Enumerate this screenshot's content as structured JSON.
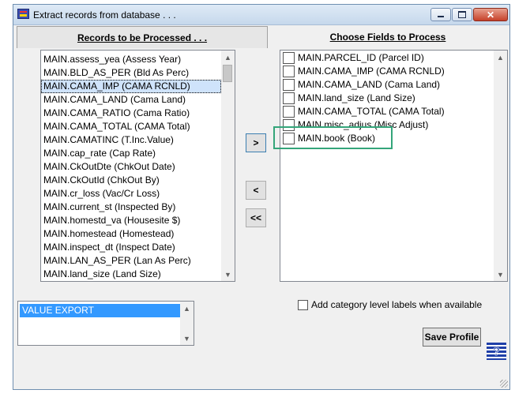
{
  "window": {
    "title": "Extract records from database . . ."
  },
  "left_panel": {
    "header": "Records to be Processed . . .",
    "items": [
      "MAIN.assess_yea (Assess Year)",
      "MAIN.BLD_AS_PER (Bld As Perc)",
      "MAIN.CAMA_IMP (CAMA RCNLD)",
      "MAIN.CAMA_LAND (Cama Land)",
      "MAIN.CAMA_RATIO (Cama Ratio)",
      "MAIN.CAMA_TOTAL (CAMA Total)",
      "MAIN.CAMATINC (T.Inc.Value)",
      "MAIN.cap_rate (Cap Rate)",
      "MAIN.CkOutDte (ChkOut Date)",
      "MAIN.CkOutId (ChkOut By)",
      "MAIN.cr_loss (Vac/Cr Loss)",
      "MAIN.current_st (Inspected By)",
      "MAIN.homestd_va (Housesite $)",
      "MAIN.homestead (Homestead)",
      "MAIN.inspect_dt (Inspect Date)",
      "MAIN.LAN_AS_PER (Lan As Perc)",
      "MAIN.land_size (Land Size)"
    ],
    "selected_index": 2
  },
  "right_panel": {
    "header": "Choose Fields to Process",
    "items": [
      "MAIN.PARCEL_ID (Parcel ID)",
      "MAIN.CAMA_IMP (CAMA RCNLD)",
      "MAIN.CAMA_LAND (Cama Land)",
      "MAIN.land_size (Land Size)",
      "MAIN.CAMA_TOTAL (CAMA Total)",
      "MAIN.misc_adjus (Misc Adjust)",
      "MAIN.book (Book)"
    ]
  },
  "move_buttons": {
    "add": ">",
    "remove": "<",
    "remove_all": "<<"
  },
  "profiles": {
    "items": [
      "VALUE EXPORT"
    ]
  },
  "options": {
    "category_labels": "Add category level labels when available"
  },
  "save_profile_label": "Save Profile",
  "colors": {
    "selection_blue": "#3399ff",
    "highlight_green": "#34a57a"
  }
}
